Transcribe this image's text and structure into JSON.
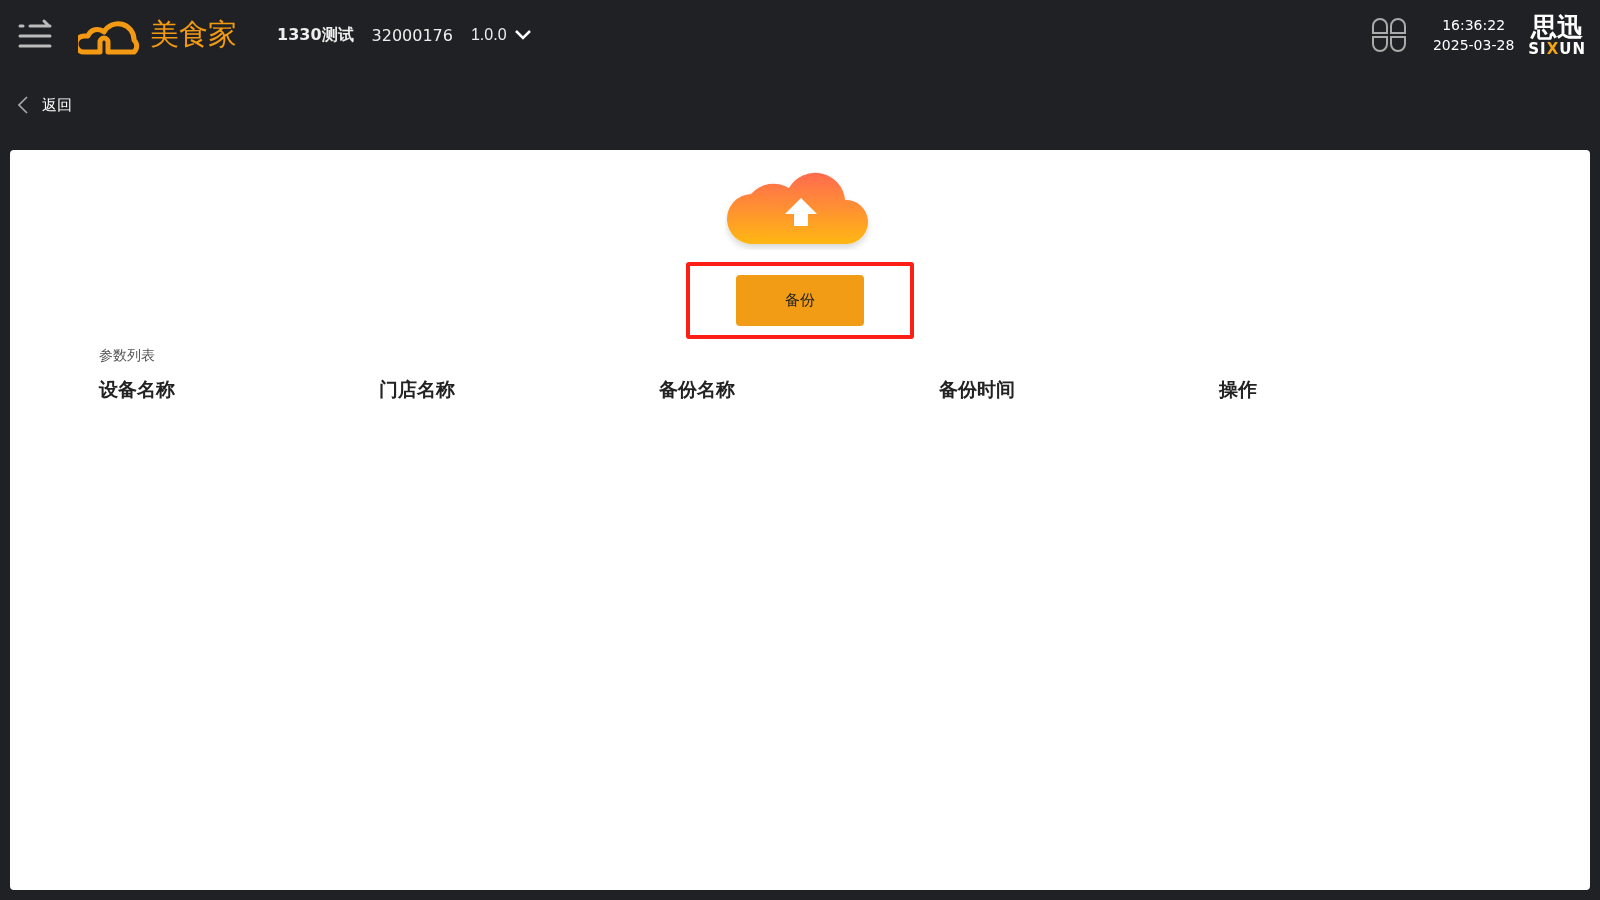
{
  "header": {
    "brand": "美食家",
    "store": "1330测试",
    "store_code": "32000176",
    "version": "1.0.0",
    "time": "16:36:22",
    "date": "2025-03-28",
    "vendor_logo": {
      "cn": "思迅",
      "en_before": "SI",
      "en_accent": "X",
      "en_after": "UN"
    }
  },
  "back_link": "返回",
  "backup_button": {
    "label": "备份",
    "highlighted": true
  },
  "table": {
    "caption": "参数列表",
    "columns": [
      "设备名称",
      "门店名称",
      "备份名称",
      "备份时间",
      "操作"
    ]
  }
}
